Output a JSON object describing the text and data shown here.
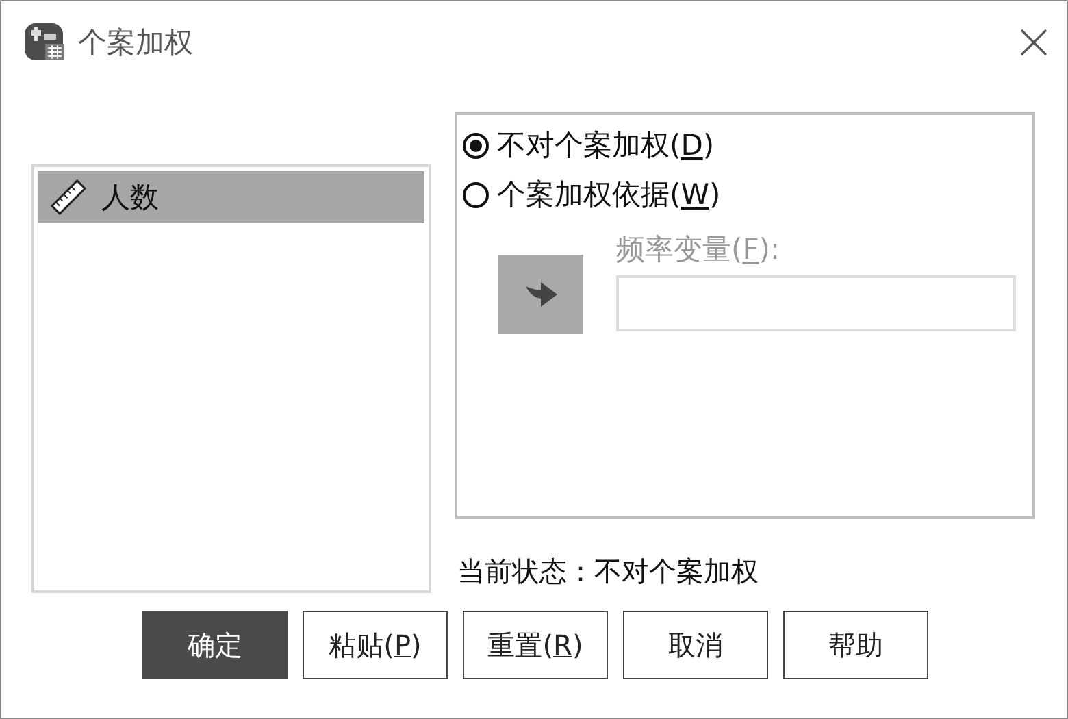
{
  "window": {
    "title": "个案加权"
  },
  "variables": [
    {
      "name": "人数",
      "selected": true
    }
  ],
  "options": [
    {
      "label": "不对个案加权(",
      "access_key": "D",
      "label_end": ")",
      "selected": true
    },
    {
      "label": "个案加权依据(",
      "access_key": "W",
      "label_end": ")",
      "selected": false
    }
  ],
  "frequency_variable": {
    "label": "频率变量(",
    "access_key": "F",
    "label_end": "):",
    "disabled": true
  },
  "status": "当前状态：不对个案加权",
  "buttons": [
    {
      "label": "确定",
      "default": true
    },
    {
      "label": "粘贴(",
      "access_key": "P",
      "label_end": ")",
      "default": false
    },
    {
      "label": "重置(",
      "access_key": "R",
      "label_end": ")",
      "default": false
    },
    {
      "label": "取消",
      "default": false
    },
    {
      "label": "帮助",
      "default": false
    }
  ]
}
